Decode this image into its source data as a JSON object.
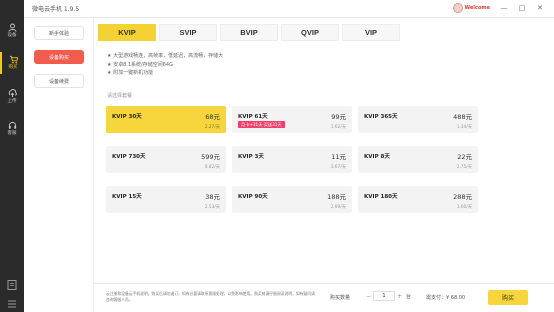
{
  "app": {
    "title": "微电云手机 1.9.5"
  },
  "user": {
    "name": "Welcome"
  },
  "window_controls": {
    "minimize": "—",
    "maximize": "□",
    "close": "✕"
  },
  "sidebar": {
    "items": [
      {
        "label": "设备",
        "icon": "device-icon"
      },
      {
        "label": "购买",
        "icon": "cart-icon"
      },
      {
        "label": "上传",
        "icon": "upload-icon"
      },
      {
        "label": "客服",
        "icon": "support-icon"
      }
    ],
    "active_index": 1
  },
  "submenu": {
    "items": [
      "新手体验",
      "设备购买",
      "设备续费"
    ],
    "active_index": 1
  },
  "tabs": [
    "KVIP",
    "SVIP",
    "BVIP",
    "QVIP",
    "VIP"
  ],
  "active_tab": 0,
  "features": [
    "★ 大型游戏畅连，高帧率，低延迟，高流畅，存储大",
    "★ 安卓8.1系统/存储空间64G",
    "★ 附加一键新机功能"
  ],
  "plan_section_label": "请选择套餐",
  "plans": [
    {
      "name": "KVIP 30天",
      "price": "68元",
      "unit_price": "2.27/天",
      "badge": ""
    },
    {
      "name": "KVIP 61天",
      "price": "99元",
      "unit_price": "1.62/天",
      "badge": "月卡+31天·买送31天"
    },
    {
      "name": "KVIP 365天",
      "price": "488元",
      "unit_price": "1.34/天",
      "badge": ""
    },
    {
      "name": "KVIP 730天",
      "price": "599元",
      "unit_price": "0.82/天",
      "badge": ""
    },
    {
      "name": "KVIP 3天",
      "price": "11元",
      "unit_price": "3.67/天",
      "badge": ""
    },
    {
      "name": "KVIP 8天",
      "price": "22元",
      "unit_price": "2.75/天",
      "badge": ""
    },
    {
      "name": "KVIP 15天",
      "price": "38元",
      "unit_price": "2.53/天",
      "badge": ""
    },
    {
      "name": "KVIP 90天",
      "price": "188元",
      "unit_price": "2.09/天",
      "badge": ""
    },
    {
      "name": "KVIP 180天",
      "price": "288元",
      "unit_price": "1.60/天",
      "badge": ""
    }
  ],
  "selected_plan_index": 0,
  "bottom": {
    "notice": "云注册和设备云手机说明，购买后请勿退订，如有必要请联系客服处理，以免影响使用。购买前请仔细阅读说明，如有疑问请咨询客服人员。",
    "quantity_label": "购买数量",
    "quantity_value": "1",
    "quantity_unit": "台",
    "minus": "−",
    "plus": "+",
    "total": "需支付：¥ 68.00",
    "buy_label": "购买"
  },
  "colors": {
    "accent": "#f7d53c",
    "active_menu": "#f25c4f",
    "badge": "#f0416c",
    "sidebar": "#2b2b2b"
  }
}
